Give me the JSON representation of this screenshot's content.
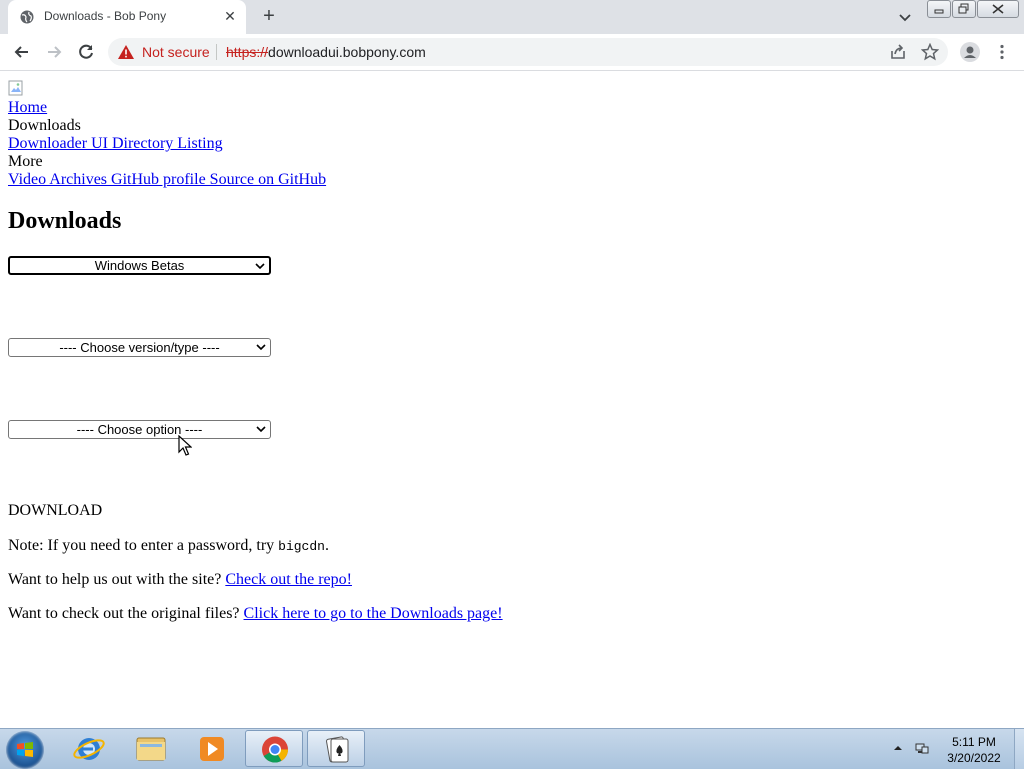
{
  "browser": {
    "tab_title": "Downloads - Bob Pony",
    "security_label": "Not secure",
    "url_scheme": "https://",
    "url_host": "downloadui.bobpony.com"
  },
  "nav": {
    "home": "Home",
    "downloads": "Downloads",
    "directory_listing": "Downloader UI Directory Listing",
    "more": "More",
    "more_links": "Video Archives GitHub profile Source on GitHub"
  },
  "main": {
    "heading": "Downloads",
    "category_select": "Windows Betas",
    "version_select": "---- Choose version/type ----",
    "option_select": "---- Choose option ----",
    "download_label": "DOWNLOAD",
    "note_prefix": "Note: If you need to enter a password, try ",
    "note_password": "bigcdn",
    "note_suffix": ".",
    "help_text": "Want to help us out with the site? ",
    "help_link": "Check out the repo!",
    "original_text": "Want to check out the original files? ",
    "original_link": "Click here to go to the Downloads page!"
  },
  "taskbar": {
    "time": "5:11 PM",
    "date": "3/20/2022"
  },
  "colors": {
    "link": "#0000ee",
    "not_secure_red": "#c5221f",
    "tabstrip": "#dee1e6",
    "taskbar": "#b9cfe5"
  }
}
